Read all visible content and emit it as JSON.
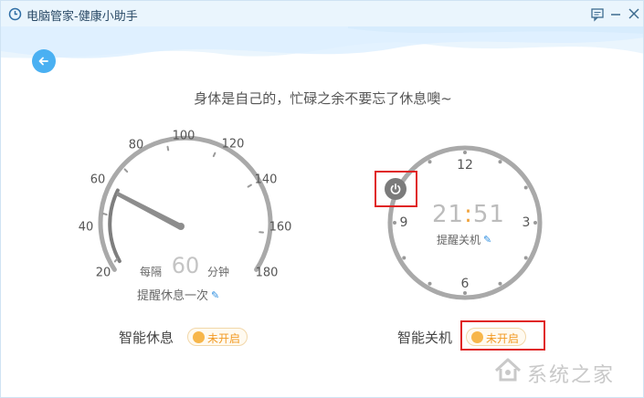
{
  "window": {
    "title": "电脑管家-健康小助手",
    "icons": {
      "app": "clock-icon",
      "feedback": "feedback-icon",
      "minimize": "minimize-icon",
      "close": "close-icon"
    }
  },
  "header": {
    "back_icon": "arrow-left-icon",
    "slogan": "身体是自己的，忙碌之余不要忘了休息噢~"
  },
  "rest_reminder": {
    "gauge_labels": [
      "20",
      "40",
      "60",
      "80",
      "100",
      "120",
      "140",
      "160",
      "180"
    ],
    "interval_prefix": "每隔",
    "interval_value": "60",
    "interval_unit": "分钟",
    "edit_label": "提醒休息一次",
    "feature_label": "智能休息",
    "toggle_label": "未开启"
  },
  "smart_shutdown": {
    "clock_numbers": {
      "top": "12",
      "right": "3",
      "bottom": "6",
      "left": "9"
    },
    "time_hour": "21",
    "time_sep": ":",
    "time_minute": "51",
    "edit_label": "提醒关机",
    "feature_label": "智能关机",
    "toggle_label": "未开启",
    "power_icon": "power-icon"
  },
  "watermark": {
    "text": "系统之家",
    "logo": "house-logo-icon"
  },
  "colors": {
    "accent": "#4ab0f2",
    "toggle_orange": "#f7b64a",
    "highlight_red": "#e02424",
    "gauge_gray": "#a9a9a9"
  }
}
